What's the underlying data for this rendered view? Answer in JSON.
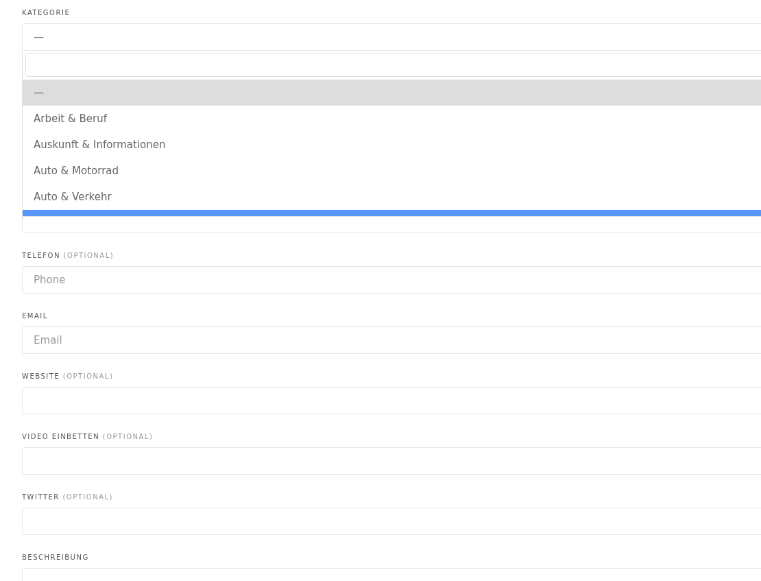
{
  "fields": [
    {
      "kind": "select",
      "label": "KATEGORIE",
      "value": "—"
    },
    {
      "kind": "covered"
    },
    {
      "kind": "input",
      "label": "TELEFON",
      "optional": "(OPTIONAL)",
      "placeholder": "Phone"
    },
    {
      "kind": "input",
      "label": "EMAIL",
      "placeholder": "Email"
    },
    {
      "kind": "input",
      "label": "WEBSITE",
      "optional": "(OPTIONAL)"
    },
    {
      "kind": "input",
      "label": "VIDEO EINBETTEN",
      "optional": "(OPTIONAL)"
    },
    {
      "kind": "input",
      "label": "TWITTER",
      "optional": "(OPTIONAL)"
    },
    {
      "kind": "input",
      "label": "BESCHREIBUNG"
    }
  ],
  "dropdown": {
    "options": [
      {
        "label": "—",
        "selected": true
      },
      {
        "label": "Arbeit & Beruf",
        "selected": false
      },
      {
        "label": "Auskunft & Informationen",
        "selected": false
      },
      {
        "label": "Auto & Motorrad",
        "selected": false
      },
      {
        "label": "Auto & Verkehr",
        "selected": false
      }
    ],
    "next_option_highlighted": true
  }
}
